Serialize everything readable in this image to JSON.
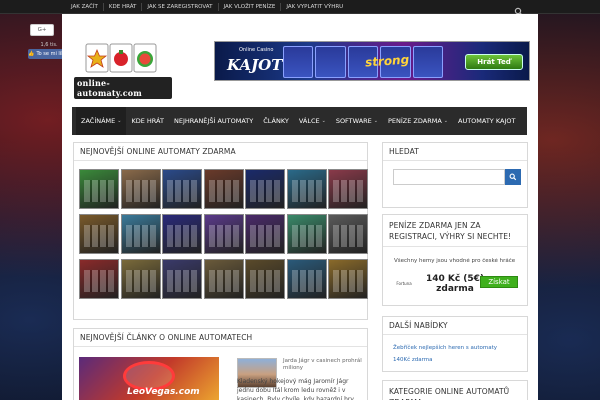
{
  "top_nav": [
    {
      "label": "JAK ZAČÍT"
    },
    {
      "label": "KDE HRÁT"
    },
    {
      "label": "JAK SE ZAREGISTROVAT"
    },
    {
      "label": "JAK VLOŽIT PENÍZE"
    },
    {
      "label": "JAK VYPLATIT VÝHRU"
    }
  ],
  "social": {
    "gplus_label": "G+",
    "fb_count": "1,6 tis.",
    "fb_like_label": "To se mi líbí"
  },
  "logo": {
    "text": "online-automaty.com"
  },
  "banner": {
    "small_text": "Online Casino",
    "brand": "KAJOT",
    "title": "strong",
    "button": "Hrát Teď"
  },
  "main_nav": [
    {
      "label": "ZAČÍNÁME",
      "dropdown": true
    },
    {
      "label": "KDE HRÁT",
      "dropdown": false
    },
    {
      "label": "NEJHRANĚJŠÍ AUTOMATY",
      "dropdown": false
    },
    {
      "label": "ČLÁNKY",
      "dropdown": false
    },
    {
      "label": "VÁLCE",
      "dropdown": true
    },
    {
      "label": "SOFTWARE",
      "dropdown": true
    },
    {
      "label": "PENÍZE ZDARMA",
      "dropdown": true
    },
    {
      "label": "AUTOMATY KAJOT",
      "dropdown": false
    }
  ],
  "slots_panel": {
    "title": "NEJNOVĚJŠÍ ONLINE AUTOMATY ZDARMA",
    "thumb_colors": [
      "#3a8a3a",
      "#8a6a4a",
      "#2a4a8a",
      "#6a3a2a",
      "#1a2a6a",
      "#2a6a8a",
      "#8a3a4a",
      "#7a5a2a",
      "#3a7a9a",
      "#2a2a7a",
      "#5a3a8a",
      "#4a2a6a",
      "#3a8a6a",
      "#5a5a5a",
      "#8a2a2a",
      "#7a6a3a",
      "#3a3a6a",
      "#6a5a3a",
      "#5a4a2a",
      "#2a5a7a",
      "#8a6a2a"
    ]
  },
  "articles_panel": {
    "title": "NEJNOVĚJŠÍ ČLÁNKY O ONLINE AUTOMATECH",
    "image_text": "LeoVegas.com",
    "meta": "Jarda Jágr v casinech prohrál miliony",
    "excerpt": "Kladenský hokejový mág Jaromír Jágr jednu dobu Itál krom ledu rovněž i v kasinech. Byly chvíle, kdy hazardní hry doslova zbožňoval a..."
  },
  "search_panel": {
    "title": "HLEDAT"
  },
  "bonus_panel": {
    "title": "PENÍZE ZDARMA JEN ZA REGISTRACI, VÝHRY SI NECHTE!",
    "note": "Všechny hemy jsou vhodné pro české hráče",
    "logo_label": "Fortuna",
    "amount": "140 Kč (5€) zdarma",
    "button": "Získat"
  },
  "offers_panel": {
    "title": "DALŠÍ NABÍDKY",
    "links": [
      {
        "label": "Žebříček nejlepších heren s automaty"
      },
      {
        "label": "140Kč zdarma"
      }
    ]
  },
  "categories_panel": {
    "title": "KATEGORIE ONLINE AUTOMATŮ ZDARMA"
  }
}
